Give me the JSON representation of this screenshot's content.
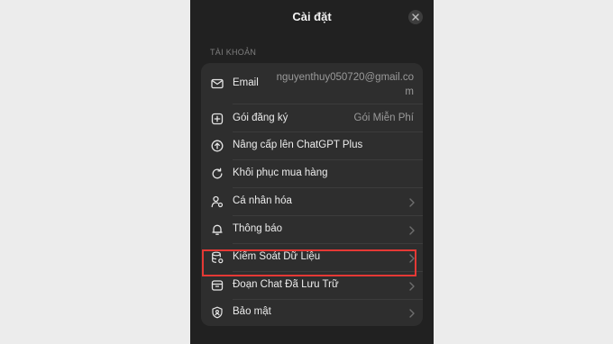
{
  "header": {
    "title": "Cài đặt"
  },
  "section": {
    "label": "TÀI KHOẢN"
  },
  "rows": [
    {
      "label": "Email",
      "value": "nguyenthuy050720@gmail.com",
      "icon": "mail-icon"
    },
    {
      "label": "Gói đăng ký",
      "value": "Gói Miễn Phí",
      "icon": "plus-square-icon"
    },
    {
      "label": "Nâng cấp lên ChatGPT Plus",
      "icon": "arrow-up-circle-icon"
    },
    {
      "label": "Khôi phục mua hàng",
      "icon": "refresh-icon"
    },
    {
      "label": "Cá nhân hóa",
      "icon": "person-gear-icon"
    },
    {
      "label": "Thông báo",
      "icon": "bell-icon"
    },
    {
      "label": "Kiểm Soát Dữ Liệu",
      "icon": "database-gear-icon"
    },
    {
      "label": "Đoạn Chat Đã Lưu Trữ",
      "icon": "archive-icon"
    },
    {
      "label": "Bảo mật",
      "icon": "shield-icon"
    }
  ],
  "colors": {
    "background": "#212121",
    "card": "#2e2e2e",
    "highlight": "#e53935"
  }
}
